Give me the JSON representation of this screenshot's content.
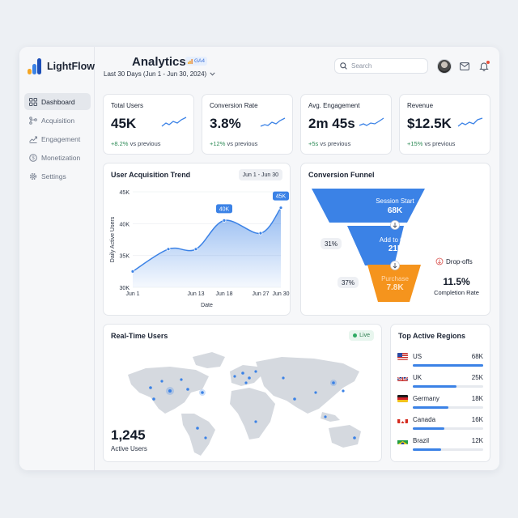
{
  "brand": {
    "name": "LightFlow",
    "colors": [
      "#f5a623",
      "#3b82e6",
      "#1d4fb8"
    ]
  },
  "sidebar": {
    "items": [
      {
        "label": "Dashboard",
        "icon": "grid-icon",
        "active": true
      },
      {
        "label": "Acquisition",
        "icon": "branch-icon",
        "active": false
      },
      {
        "label": "Engagement",
        "icon": "trend-icon",
        "active": false
      },
      {
        "label": "Monetization",
        "icon": "dollar-icon",
        "active": false
      },
      {
        "label": "Settings",
        "icon": "gear-icon",
        "active": false
      }
    ]
  },
  "header": {
    "title": "Analytics",
    "badge": "GA4",
    "date_range": "Last 30 Days (Jun 1 - Jun 30, 2024)",
    "search_placeholder": "Search",
    "icons": [
      "search-icon",
      "avatar",
      "mail-icon",
      "bell-icon"
    ]
  },
  "kpis": [
    {
      "label": "Total Users",
      "value": "45K",
      "delta": "+8.2%",
      "delta_suffix": "vs previous"
    },
    {
      "label": "Conversion Rate",
      "value": "3.8%",
      "delta": "+12%",
      "delta_suffix": "vs previous"
    },
    {
      "label": "Avg. Engagement",
      "value": "2m 45s",
      "delta": "+5s",
      "delta_suffix": "vs previous"
    },
    {
      "label": "Revenue",
      "value": "$12.5K",
      "delta": "+15%",
      "delta_suffix": "vs previous"
    }
  ],
  "trend": {
    "title": "User Acquisition Trend",
    "range": "Jun 1 - Jun 30",
    "chart_data": {
      "type": "area",
      "x": [
        "Jun 1",
        "Jun 6",
        "Jun 13",
        "Jun 18",
        "Jun 27",
        "Jun 30"
      ],
      "y": [
        32.5,
        36,
        36,
        40.5,
        38.5,
        42.5
      ],
      "xticks": [
        "Jun 1",
        "Jun 13",
        "Jun 18",
        "Jun 27",
        "Jun 30"
      ],
      "yticks": [
        "45K",
        "40K",
        "35K",
        "30K"
      ],
      "ylim": [
        30,
        45
      ],
      "xlabel": "Date",
      "ylabel": "Daily Active Users",
      "annotations": [
        {
          "x": "Jun 18",
          "label": "40K"
        },
        {
          "x": "Jun 30",
          "label": "45K"
        }
      ],
      "color": "#3b82e6"
    }
  },
  "funnel": {
    "title": "Conversion Funnel",
    "stages": [
      {
        "label": "Session Start",
        "value": "68K",
        "color": "#3b82e6"
      },
      {
        "label": "Add to Cart",
        "value": "21K",
        "color": "#3b82e6"
      },
      {
        "label": "Purchase",
        "value": "7.8K",
        "color": "#f5941d"
      }
    ],
    "step_rates": [
      "31%",
      "37%"
    ],
    "dropoffs_label": "Drop-offs",
    "completion_value": "11.5%",
    "completion_label": "Completion Rate"
  },
  "realtime": {
    "title": "Real-Time Users",
    "live": "Live",
    "value": "1,245",
    "label": "Active Users"
  },
  "regions": {
    "title": "Top Active Regions",
    "items": [
      {
        "name": "US",
        "value": "68K",
        "share": 1.0,
        "flag": "us-flag"
      },
      {
        "name": "UK",
        "value": "25K",
        "share": 0.62,
        "flag": "uk-flag"
      },
      {
        "name": "Germany",
        "value": "18K",
        "share": 0.5,
        "flag": "germany-flag"
      },
      {
        "name": "Canada",
        "value": "16K",
        "share": 0.45,
        "flag": "canada-flag"
      },
      {
        "name": "Brazil",
        "value": "12K",
        "share": 0.4,
        "flag": "brazil-flag"
      }
    ]
  }
}
